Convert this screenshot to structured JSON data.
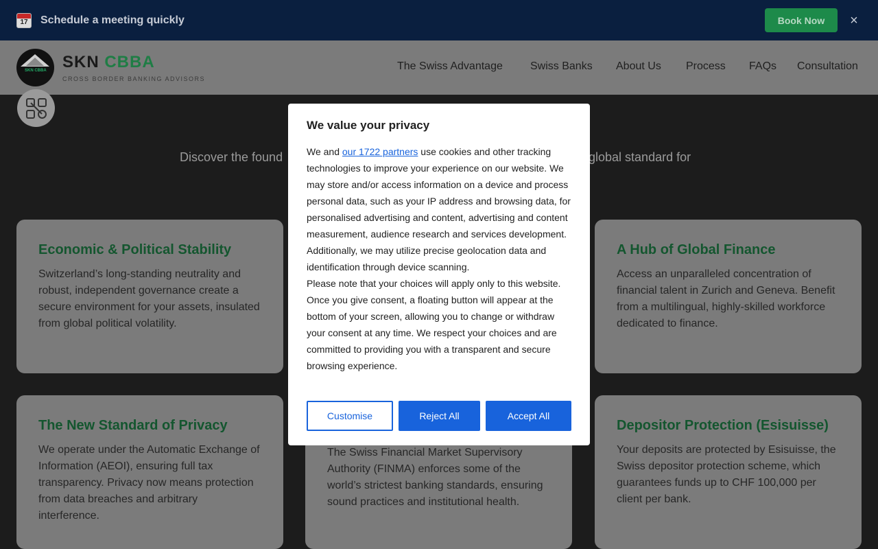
{
  "promo": {
    "calendar_day": "17",
    "text": "Schedule a meeting quickly",
    "book_label": "Book Now",
    "close_label": "×"
  },
  "header": {
    "brand_part1": "SKN",
    "brand_part2": "CBBA",
    "tagline": "CROSS BORDER BANKING ADVISORS",
    "logo_text": "SKN CBBA",
    "nav": [
      "The Swiss Advantage",
      "Swiss Banks",
      "About Us",
      "Process",
      "FAQs",
      "Consultation"
    ]
  },
  "hero": {
    "left_text": "Discover the found",
    "right_text": "global standard for"
  },
  "cards": [
    {
      "title": "Economic & Political Stability",
      "body": "Switzerland’s long-standing neutrality and robust, independent governance create a secure environment for your assets, insulated from global political volatility."
    },
    {
      "title": "A Hub of Global Finance",
      "body": "Access an unparalleled concentration of financial talent in Zurich and Geneva. Benefit from a multilingual, highly-skilled workforce dedicated to finance."
    },
    {
      "title": "The New Standard of Privacy",
      "body": "We operate under the Automatic Exchange of Information (AEOI), ensuring full tax transparency. Privacy now means protection from data breaches and arbitrary interference."
    },
    {
      "title": "",
      "body": "The Swiss Financial Market Supervisory Authority (FINMA) enforces some of the world’s strictest banking standards, ensuring sound practices and institutional health."
    },
    {
      "title": "Depositor Protection (Esisuisse)",
      "body": "Your deposits are protected by Esisuisse, the Swiss depositor protection scheme, which guarantees funds up to CHF 100,000 per client per bank."
    }
  ],
  "consent": {
    "title": "We value your privacy",
    "body_prefix": "We and ",
    "partners_link": "our 1722 partners",
    "body_p1_rest": " use cookies and other tracking technologies to improve your experience on our website. We may store and/or access information on a device and process personal data, such as your IP address and browsing data, for personalised advertising and content, advertising and content measurement, audience research and services development. Additionally, we may utilize precise geolocation data and identification through device scanning.",
    "body_p2": "Please note that your choices will apply only to this website. Once you give consent, a floating button will appear at the bottom of your screen, allowing you to change or withdraw your consent at any time. We respect your choices and are committed to providing you with a transparent and secure browsing experience.",
    "customise_label": "Customise",
    "reject_label": "Reject All",
    "accept_label": "Accept All"
  }
}
